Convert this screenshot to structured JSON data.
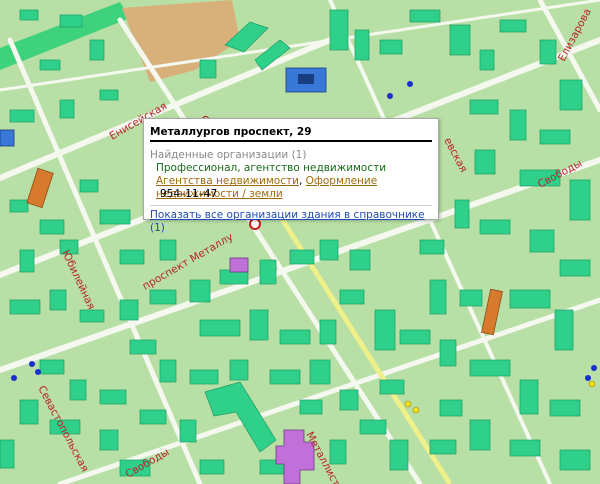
{
  "streets": {
    "eniseyskaya": "Енисейская",
    "prospekt_metallurgov": "проспект Металлу",
    "yubileynaya": "Юбилейная",
    "sevastopolskaya": "Севастопольская",
    "svobody_left": "Свободы",
    "svobody_right": "Свободы",
    "elizarova": "Елизарова",
    "metallistov": "Металлист",
    "vevskaya": "евская",
    "s_fragment": "С"
  },
  "popup": {
    "title": "Металлургов проспект, 29",
    "found_label": "Найденные организации (1)",
    "org_name": "Профессионал, агентство недвижимости",
    "categories": [
      "Агентства недвижимости",
      "Оформление недвижимости / земли"
    ],
    "category_separator": ", ",
    "phone": "954–11–47",
    "show_all_link": "Показать все организации здания в справочнике",
    "show_all_count": "(1)"
  },
  "colors": {
    "background": "#b8dfa5",
    "building": "#2fd08a",
    "building_top": "#5ee8a8",
    "road": "#f4f8ee",
    "street_label": "#b8232a",
    "link": "#1f4bb8",
    "category_link": "#a06a10"
  }
}
